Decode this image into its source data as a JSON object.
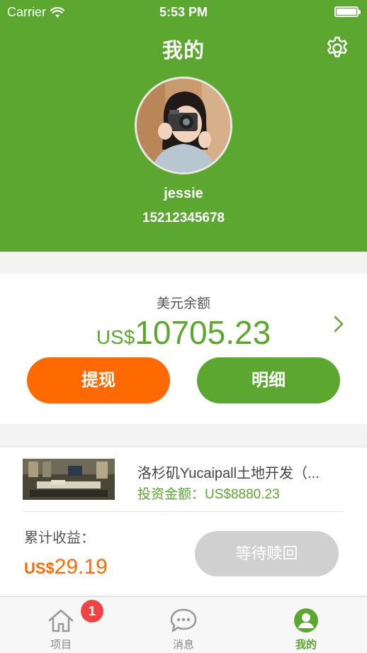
{
  "status_bar": {
    "carrier": "Carrier",
    "time": "5:53 PM"
  },
  "header": {
    "title": "我的",
    "username": "jessie",
    "phone": "15212345678"
  },
  "balance": {
    "label": "美元余额",
    "currency": "US$",
    "amount": "10705.23",
    "withdraw_label": "提现",
    "detail_label": "明细"
  },
  "project": {
    "title": "洛杉矶Yucaipall土地开发（...",
    "invest_label": "投资金额：",
    "invest_value": "US$8880.23",
    "earnings_label": "累计收益：",
    "earnings_currency": "US$",
    "earnings_amount": "29.19",
    "status_button": "等待赎回"
  },
  "tabbar": {
    "tabs": [
      {
        "label": "项目",
        "icon": "home-icon",
        "badge": "1"
      },
      {
        "label": "消息",
        "icon": "chat-bubble-icon"
      },
      {
        "label": "我的",
        "icon": "user-icon",
        "active": true
      }
    ]
  },
  "colors": {
    "brand_green": "#5ba730",
    "accent_orange": "#ff6a00",
    "disabled_gray": "#d0d0d0",
    "badge_red": "#f04444"
  }
}
